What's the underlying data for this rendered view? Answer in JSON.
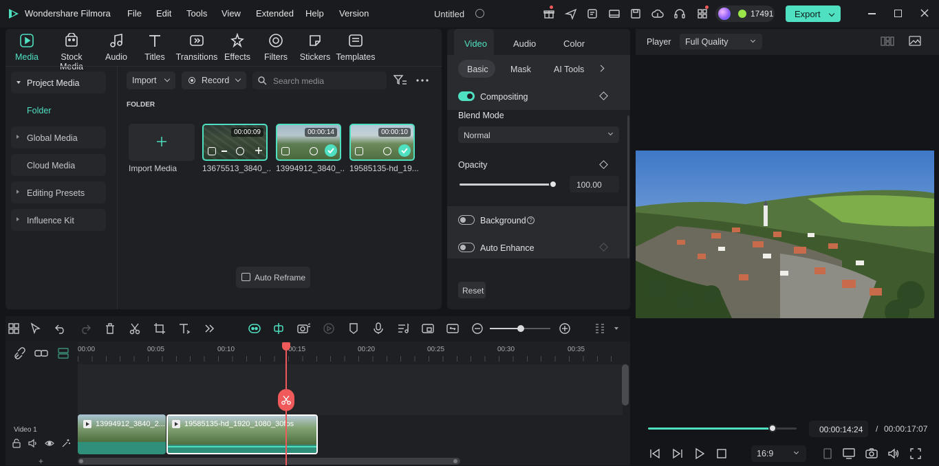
{
  "app": {
    "name": "Wondershare Filmora",
    "project_title": "Untitled",
    "credits": "17491",
    "export_label": "Export"
  },
  "menu": [
    "File",
    "Edit",
    "Tools",
    "View",
    "Extended",
    "Help",
    "Version"
  ],
  "toolbar": {
    "tabs": [
      {
        "label": "Media",
        "icon": "media-icon"
      },
      {
        "label": "Stock Media",
        "icon": "stock-media-icon"
      },
      {
        "label": "Audio",
        "icon": "audio-icon"
      },
      {
        "label": "Titles",
        "icon": "titles-icon"
      },
      {
        "label": "Transitions",
        "icon": "transitions-icon"
      },
      {
        "label": "Effects",
        "icon": "effects-icon"
      },
      {
        "label": "Filters",
        "icon": "filters-icon"
      },
      {
        "label": "Stickers",
        "icon": "stickers-icon"
      },
      {
        "label": "Templates",
        "icon": "templates-icon"
      }
    ],
    "active_tab": "Media"
  },
  "sidebar": {
    "items": [
      "Project Media",
      "Folder",
      "Global Media",
      "Cloud Media",
      "Editing Presets",
      "Influence Kit"
    ]
  },
  "media": {
    "import_label": "Import",
    "record_label": "Record",
    "search_placeholder": "Search media",
    "folder_heading": "FOLDER",
    "import_media_label": "Import Media",
    "auto_reframe_label": "Auto Reframe",
    "items": [
      {
        "name": "13675513_3840_...",
        "duration": "00:00:09"
      },
      {
        "name": "13994912_3840_...",
        "duration": "00:00:14"
      },
      {
        "name": "19585135-hd_19...",
        "duration": "00:00:10"
      }
    ]
  },
  "properties": {
    "tabs": [
      "Video",
      "Audio",
      "Color"
    ],
    "active_tab": "Video",
    "subtabs": [
      "Basic",
      "Mask",
      "AI Tools"
    ],
    "active_subtab": "Basic",
    "compositing_label": "Compositing",
    "blend_mode_label": "Blend Mode",
    "blend_mode_value": "Normal",
    "opacity_label": "Opacity",
    "opacity_value": "100.00",
    "opacity_fraction": 1.0,
    "background_label": "Background",
    "auto_enhance_label": "Auto Enhance",
    "reset_label": "Reset"
  },
  "player": {
    "label": "Player",
    "quality": "Full Quality",
    "current_time": "00:00:14:24",
    "separator": "/",
    "total_time": "00:00:17:07",
    "aspect_ratio": "16:9",
    "progress_fraction": 0.84
  },
  "timeline": {
    "ruler": [
      "00:00",
      "00:05",
      "00:10",
      "00:15",
      "00:20",
      "00:25",
      "00:30",
      "00:35"
    ],
    "track_label": "Video 1",
    "clips": [
      {
        "name": "13994912_3840_2..."
      },
      {
        "name": "19585135-hd_1920_1080_30fps"
      }
    ],
    "add_track": "+"
  },
  "colors": {
    "accent": "#4fe0c1",
    "playhead": "#f05a5a",
    "background": "#141518",
    "panel": "#1f2024"
  }
}
